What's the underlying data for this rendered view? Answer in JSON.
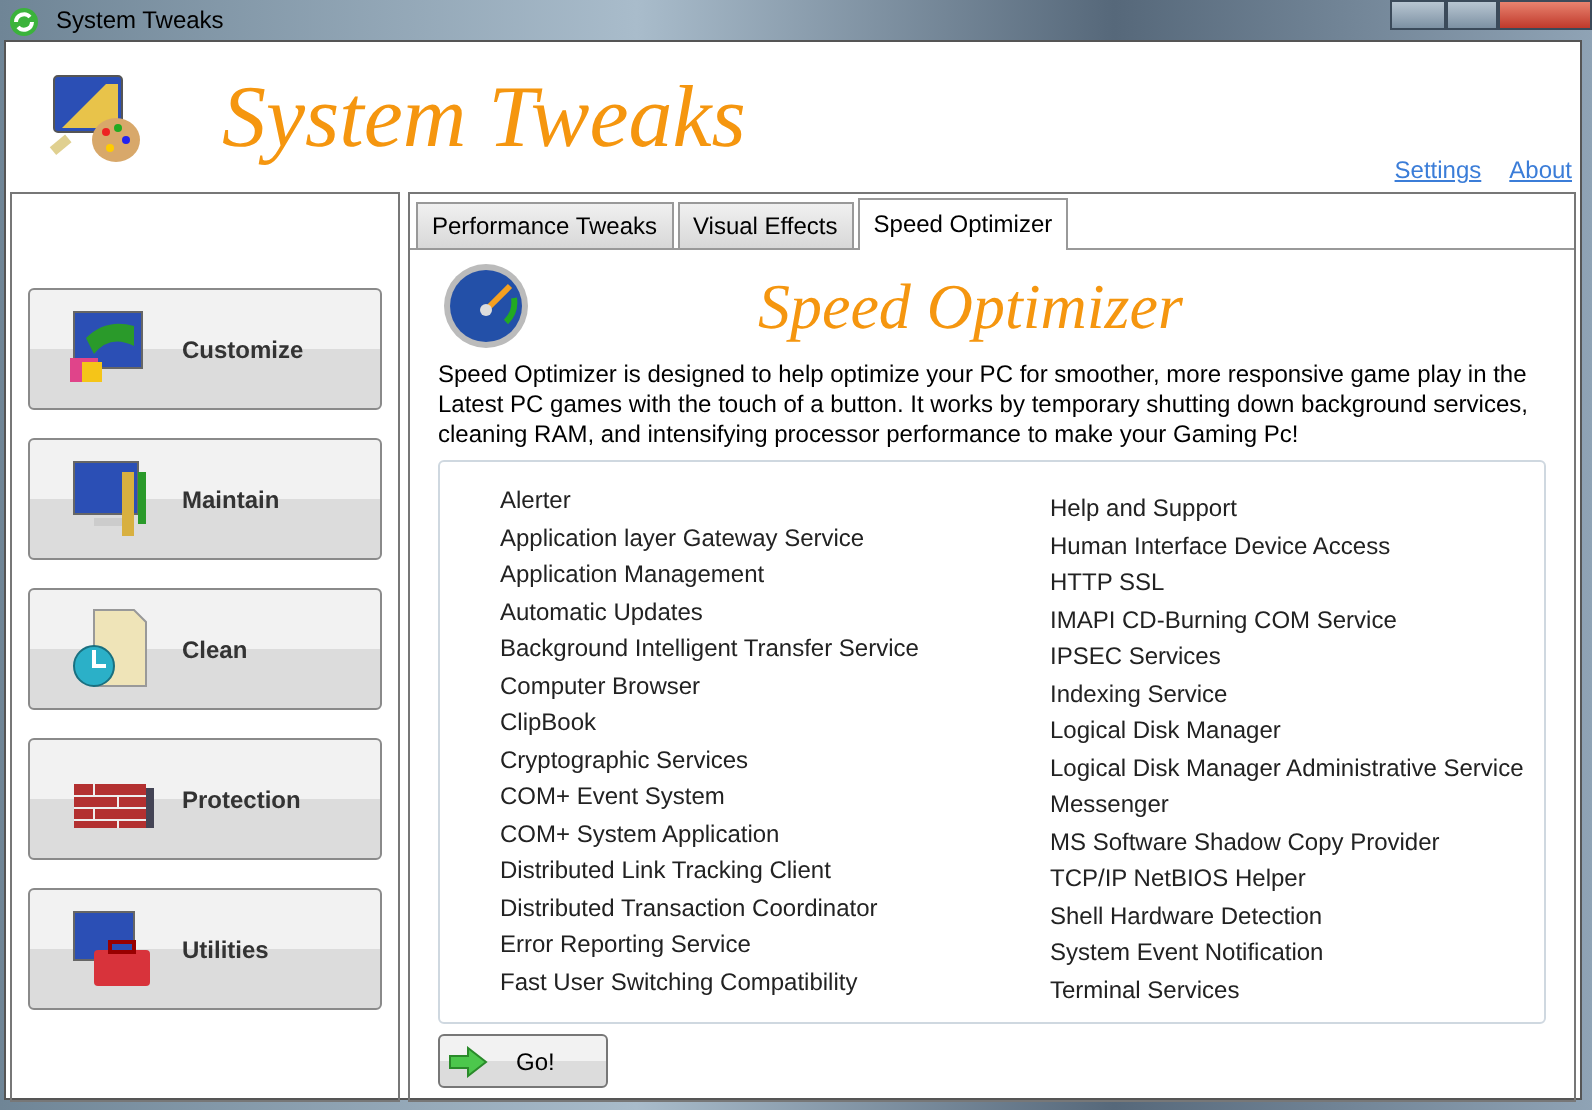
{
  "window": {
    "title": "System Tweaks"
  },
  "header": {
    "title": "System Tweaks",
    "links": [
      "Settings",
      "About"
    ]
  },
  "sidebar": {
    "items": [
      {
        "label": "Customize",
        "kind": "customize"
      },
      {
        "label": "Maintain",
        "kind": "maintain"
      },
      {
        "label": "Clean",
        "kind": "clean"
      },
      {
        "label": "Protection",
        "kind": "protection"
      },
      {
        "label": "Utilities",
        "kind": "utilities"
      }
    ]
  },
  "tabs": [
    {
      "label": "Performance Tweaks",
      "selected": false
    },
    {
      "label": "Visual Effects",
      "selected": false
    },
    {
      "label": "Speed Optimizer",
      "selected": true
    }
  ],
  "panel": {
    "title": "Speed Optimizer",
    "description": "Speed Optimizer is designed to help optimize your PC for smoother, more responsive game play in the Latest PC games with the touch of a button. It works by temporary shutting down background services, cleaning RAM, and intensifying processor performance to make your Gaming Pc!",
    "services_left": [
      "Alerter",
      "Application layer Gateway Service",
      "Application Management",
      "Automatic Updates",
      "Background Intelligent Transfer Service",
      "Computer Browser",
      "ClipBook",
      "Cryptographic Services",
      "COM+ Event System",
      "COM+ System Application",
      "Distributed Link Tracking Client",
      "Distributed Transaction Coordinator",
      "Error Reporting Service",
      "Fast User Switching Compatibility"
    ],
    "services_right": [
      "Help and Support",
      "Human Interface Device Access",
      "HTTP SSL",
      "IMAPI CD-Burning COM Service",
      "IPSEC Services",
      "Indexing Service",
      "Logical Disk Manager",
      "Logical Disk Manager Administrative Service",
      "Messenger",
      "MS Software Shadow Copy Provider",
      "TCP/IP NetBIOS Helper",
      "Shell Hardware Detection",
      "System Event Notification",
      "Terminal Services"
    ],
    "button": "Go!"
  }
}
